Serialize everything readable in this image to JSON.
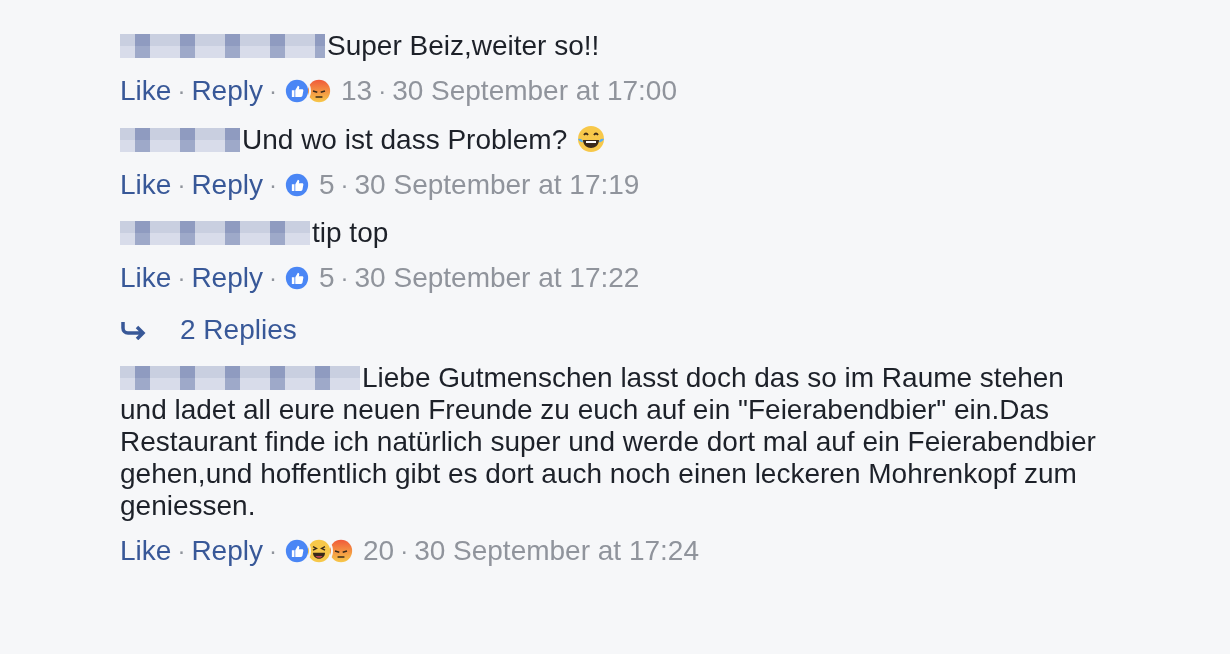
{
  "comments": [
    {
      "text": "Super Beiz,weiter so!!",
      "actions": [
        "Like",
        "Reply"
      ],
      "separator": "·",
      "reactions": [
        {
          "kind": "like"
        },
        {
          "kind": "angry"
        }
      ],
      "count": "13",
      "time": "30 September at 17:00"
    },
    {
      "text": "Und wo ist dass Problem?",
      "emoji": {
        "kind": "tears_of_joy"
      },
      "actions": [
        "Like",
        "Reply"
      ],
      "separator": "·",
      "reactions": [
        {
          "kind": "like"
        }
      ],
      "count": "5",
      "time": "30 September at 17:19"
    },
    {
      "text": "tip top",
      "actions": [
        "Like",
        "Reply"
      ],
      "separator": "·",
      "reactions": [
        {
          "kind": "like"
        }
      ],
      "count": "5",
      "time": "30 September at 17:22",
      "replies": "2 Replies"
    },
    {
      "text": "Liebe Gutmenschen lasst doch das so im Raume stehen",
      "text_continued": "und ladet all eure neuen Freunde zu euch auf ein \"Feierabendbier\" ein.Das Restaurant finde ich natürlich super und werde dort mal auf ein Feierabendbier gehen,und hoffentlich gibt es dort auch noch einen leckeren Mohrenkopf zum geniessen.",
      "actions": [
        "Like",
        "Reply"
      ],
      "separator": "·",
      "reactions": [
        {
          "kind": "like"
        },
        {
          "kind": "haha"
        },
        {
          "kind": "angry"
        }
      ],
      "count": "20",
      "time": "30 September at 17:24"
    }
  ]
}
